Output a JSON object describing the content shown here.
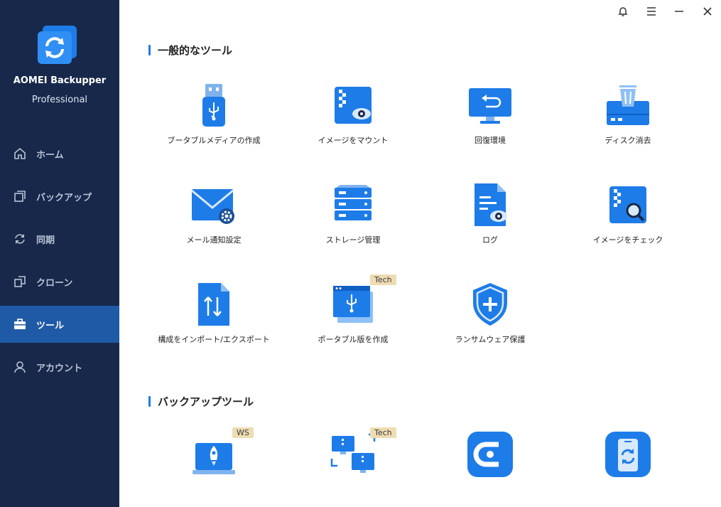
{
  "app": {
    "name": "AOMEI Backupper",
    "edition": "Professional"
  },
  "window": {
    "bell": "bell-icon",
    "menu": "menu-icon",
    "minimize": "minimize-icon",
    "close": "close-icon"
  },
  "nav": [
    {
      "label": "ホーム",
      "icon": "home-icon"
    },
    {
      "label": "バックアップ",
      "icon": "backup-icon"
    },
    {
      "label": "同期",
      "icon": "sync-icon"
    },
    {
      "label": "クローン",
      "icon": "clone-icon"
    },
    {
      "label": "ツール",
      "icon": "tools-icon",
      "active": true
    },
    {
      "label": "アカウント",
      "icon": "account-icon"
    }
  ],
  "sections": {
    "general": "一般的なツール",
    "backup": "バックアップツール"
  },
  "tools": {
    "bootable_media": "ブータブルメディアの作成",
    "mount_image": "イメージをマウント",
    "recovery_env": "回復環境",
    "disk_wipe": "ディスク消去",
    "email_settings": "メール通知設定",
    "storage_mgmt": "ストレージ管理",
    "log": "ログ",
    "check_image": "イメージをチェック",
    "import_export": "構成をインポート/エクスポート",
    "portable": "ポータブル版を作成",
    "ransomware": "ランサムウェア保護"
  },
  "badges": {
    "tech": "Tech",
    "ws": "WS"
  },
  "colors": {
    "sidebar": "#17284a",
    "active": "#1f5aa6",
    "accent": "#1e7ce8"
  }
}
